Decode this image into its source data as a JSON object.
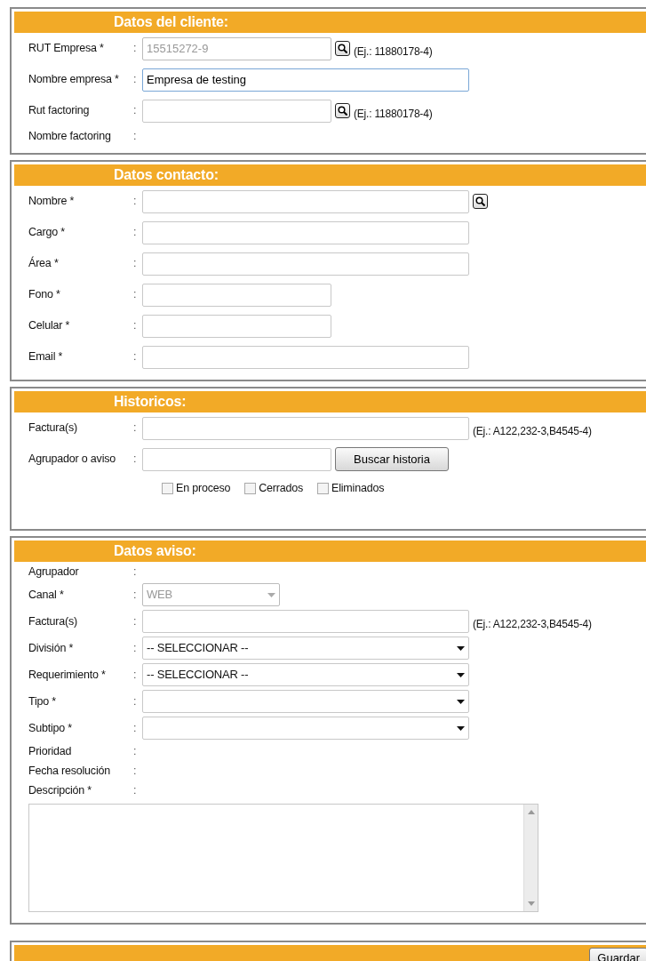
{
  "sections": [
    {
      "title": "Datos del cliente:",
      "rows": [
        {
          "kind": "input",
          "label": "RUT Empresa *",
          "separator": ":",
          "value": "15515272-9",
          "disabled": true,
          "wide": false,
          "search_button": true,
          "hint": "(Ej.: 11880178-4)"
        },
        {
          "kind": "input",
          "label": "Nombre empresa *",
          "separator": ":",
          "value": "Empresa de testing",
          "disabled": false,
          "wide": true,
          "search_button": false
        },
        {
          "kind": "input",
          "label": "Rut factoring",
          "separator": ":",
          "disabled": false,
          "wide": false,
          "search_button": true,
          "hint": "(Ej.: 11880178-4)"
        },
        {
          "kind": "text",
          "label": "Nombre factoring",
          "separator": ":"
        }
      ]
    },
    {
      "title": "Datos contacto:",
      "rows": [
        {
          "kind": "input",
          "label": "Nombre *",
          "separator": ":",
          "disabled": false,
          "wide": true,
          "search_button": true
        },
        {
          "kind": "input",
          "label": "Cargo *",
          "separator": ":",
          "disabled": false,
          "wide": true,
          "search_button": false
        },
        {
          "kind": "input",
          "label": "Área *",
          "separator": ":",
          "disabled": false,
          "wide": true,
          "search_button": false
        },
        {
          "kind": "input",
          "label": "Fono *",
          "separator": ":",
          "disabled": false,
          "wide": false,
          "search_button": false
        },
        {
          "kind": "input",
          "label": "Celular *",
          "separator": ":",
          "disabled": false,
          "wide": false,
          "search_button": false
        },
        {
          "kind": "input",
          "label": "Email *",
          "separator": ":",
          "disabled": false,
          "wide": true,
          "search_button": false
        }
      ]
    },
    {
      "title": "Historicos:",
      "rows": [
        {
          "kind": "input",
          "label": "Factura(s)",
          "separator": ":",
          "disabled": false,
          "wide": true,
          "search_button": false,
          "hint": "(Ej.: A122,232-3,B4545-4)"
        },
        {
          "kind": "input",
          "label": "Agrupador o aviso",
          "separator": ":",
          "disabled": false,
          "wide": false,
          "search_button": false,
          "button": "Buscar historia"
        },
        {
          "kind": "checkboxes",
          "options": [
            {
              "label": "En proceso",
              "checked": false
            },
            {
              "label": "Cerrados",
              "checked": false
            },
            {
              "label": "Eliminados",
              "checked": false
            }
          ]
        }
      ]
    },
    {
      "title": "Datos aviso:",
      "rows": [
        {
          "kind": "text",
          "label": "Agrupador",
          "separator": ":"
        },
        {
          "kind": "select",
          "label": "Canal *",
          "separator": ":",
          "value": "WEB",
          "disabled": true,
          "wide": false
        },
        {
          "kind": "input",
          "label": "Factura(s)",
          "separator": ":",
          "disabled": false,
          "wide": true,
          "search_button": false,
          "hint": "(Ej.: A122,232-3,B4545-4)"
        },
        {
          "kind": "select",
          "label": "División *",
          "separator": ":",
          "value": "-- SELECCIONAR --",
          "disabled": false,
          "wide": true
        },
        {
          "kind": "select",
          "label": "Requerimiento *",
          "separator": ":",
          "value": "-- SELECCIONAR --",
          "disabled": false,
          "wide": true
        },
        {
          "kind": "select",
          "label": "Tipo *",
          "separator": ":",
          "disabled": false,
          "wide": true
        },
        {
          "kind": "select",
          "label": "Subtipo *",
          "separator": ":",
          "disabled": false,
          "wide": true
        },
        {
          "kind": "text",
          "label": "Prioridad",
          "separator": ":"
        },
        {
          "kind": "text",
          "label": "Fecha resolución",
          "separator": ":"
        },
        {
          "kind": "text",
          "label": "Descripción *",
          "separator": ":"
        },
        {
          "kind": "textarea"
        }
      ]
    }
  ],
  "footer": {
    "button": "Guardar"
  }
}
